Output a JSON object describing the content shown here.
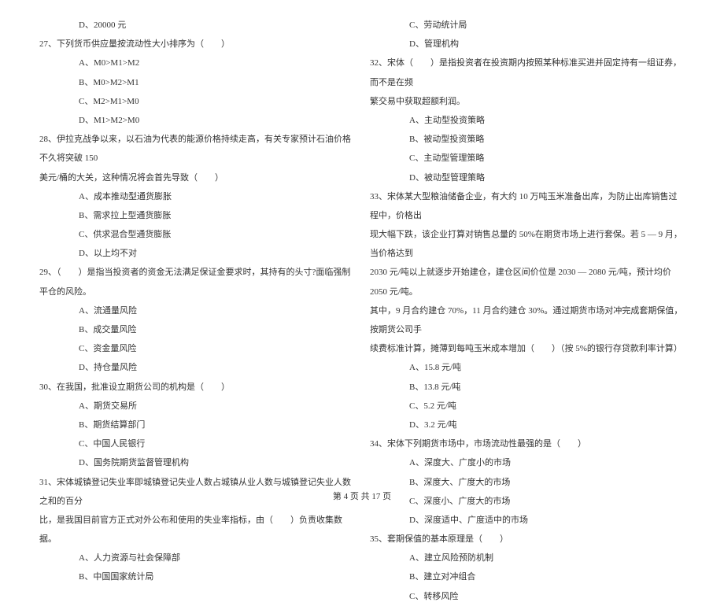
{
  "left": [
    {
      "cls": "indent-opt",
      "t": "D、20000 元"
    },
    {
      "cls": "indent-q",
      "t": "27、下列货币供应量按流动性大小排序为（　　）"
    },
    {
      "cls": "indent-opt",
      "t": "A、M0>M1>M2"
    },
    {
      "cls": "indent-opt",
      "t": "B、M0>M2>M1"
    },
    {
      "cls": "indent-opt",
      "t": "C、M2>M1>M0"
    },
    {
      "cls": "indent-opt",
      "t": "D、M1>M2>M0"
    },
    {
      "cls": "indent-q",
      "t": "28、伊拉克战争以来，以石油为代表的能源价格持续走高，有关专家预计石油价格不久将突破 150"
    },
    {
      "cls": "indent-q",
      "t": "美元/桶的大关，这种情况将会首先导致（　　）"
    },
    {
      "cls": "indent-opt",
      "t": "A、成本推动型通货膨胀"
    },
    {
      "cls": "indent-opt",
      "t": "B、需求拉上型通货膨胀"
    },
    {
      "cls": "indent-opt",
      "t": "C、供求混合型通货膨胀"
    },
    {
      "cls": "indent-opt",
      "t": "D、以上均不对"
    },
    {
      "cls": "indent-q",
      "t": "29、（　　）是指当投资者的资金无法满足保证金要求时，其持有的头寸?面临强制平仓的风险。"
    },
    {
      "cls": "indent-opt",
      "t": "A、流通量风险"
    },
    {
      "cls": "indent-opt",
      "t": "B、成交量风险"
    },
    {
      "cls": "indent-opt",
      "t": "C、资金量风险"
    },
    {
      "cls": "indent-opt",
      "t": "D、持仓量风险"
    },
    {
      "cls": "indent-q",
      "t": "30、在我国，批准设立期货公司的机构是（　　）"
    },
    {
      "cls": "indent-opt",
      "t": "A、期货交易所"
    },
    {
      "cls": "indent-opt",
      "t": "B、期货结算部门"
    },
    {
      "cls": "indent-opt",
      "t": "C、中国人民银行"
    },
    {
      "cls": "indent-opt",
      "t": "D、国务院期货监督管理机构"
    },
    {
      "cls": "indent-q",
      "t": "31、宋体城镇登记失业率即城镇登记失业人数占城镇从业人数与城镇登记失业人数之和的百分"
    },
    {
      "cls": "indent-q",
      "t": "比，是我国目前官方正式对外公布和使用的失业率指标，由（　　）负责收集数据。"
    },
    {
      "cls": "indent-opt",
      "t": "A、人力资源与社会保障部"
    },
    {
      "cls": "indent-opt",
      "t": "B、中国国家统计局"
    }
  ],
  "right": [
    {
      "cls": "indent-opt",
      "t": "C、劳动统计局"
    },
    {
      "cls": "indent-opt",
      "t": "D、管理机构"
    },
    {
      "cls": "indent-q",
      "t": "32、宋体（　　）是指投资者在投资期内按照某种标准买进并固定持有一组证券，而不是在频"
    },
    {
      "cls": "indent-q",
      "t": "繁交易中获取超额利润。"
    },
    {
      "cls": "indent-opt",
      "t": "A、主动型投资策略"
    },
    {
      "cls": "indent-opt",
      "t": "B、被动型投资策略"
    },
    {
      "cls": "indent-opt",
      "t": "C、主动型管理策略"
    },
    {
      "cls": "indent-opt",
      "t": "D、被动型管理策略"
    },
    {
      "cls": "indent-q",
      "t": "33、宋体某大型粮油储备企业，有大约 10 万吨玉米准备出库，为防止出库销售过程中，价格出"
    },
    {
      "cls": "indent-q",
      "t": "现大幅下跌，该企业打算对销售总量的 50%在期货市场上进行套保。若 5 — 9 月，当价格达到"
    },
    {
      "cls": "indent-q",
      "t": "2030 元/吨以上就逐步开始建仓，建仓区间价位是 2030 — 2080 元/吨，预计均价 2050 元/吨。"
    },
    {
      "cls": "indent-q",
      "t": "其中，9 月合约建仓 70%，11 月合约建仓 30%。通过期货市场对冲完成套期保值，按期货公司手"
    },
    {
      "cls": "indent-q",
      "t": "续费标准计算，摊薄到每吨玉米成本增加（　　）（按 5%的银行存贷款利率计算）"
    },
    {
      "cls": "indent-opt",
      "t": "A、15.8 元/吨"
    },
    {
      "cls": "indent-opt",
      "t": "B、13.8 元/吨"
    },
    {
      "cls": "indent-opt",
      "t": "C、5.2 元/吨"
    },
    {
      "cls": "indent-opt",
      "t": "D、3.2 元/吨"
    },
    {
      "cls": "indent-q",
      "t": "34、宋体下列期货市场中，市场流动性最强的是（　　）"
    },
    {
      "cls": "indent-opt",
      "t": "A、深度大、广度小的市场"
    },
    {
      "cls": "indent-opt",
      "t": "B、深度大、广度大的市场"
    },
    {
      "cls": "indent-opt",
      "t": "C、深度小、广度大的市场"
    },
    {
      "cls": "indent-opt",
      "t": "D、深度适中、广度适中的市场"
    },
    {
      "cls": "indent-q",
      "t": "35、套期保值的基本原理是（　　）"
    },
    {
      "cls": "indent-opt",
      "t": "A、建立风险预防机制"
    },
    {
      "cls": "indent-opt",
      "t": "B、建立对冲组合"
    },
    {
      "cls": "indent-opt",
      "t": "C、转移风险"
    }
  ],
  "footer": "第 4 页 共 17 页"
}
